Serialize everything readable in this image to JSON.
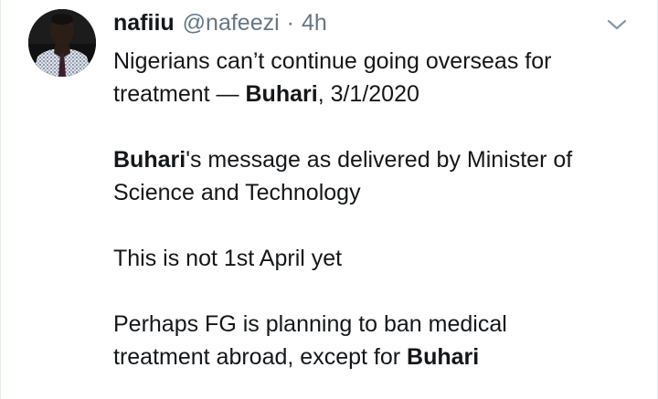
{
  "tweet": {
    "author": {
      "display_name": "nafiiu",
      "handle": "@nafeezi",
      "separator": "·",
      "time": "4h",
      "avatar_icon": "profile-photo"
    },
    "menu_icon": "chevron-down-icon",
    "paragraphs": [
      {
        "lines": [
          [
            {
              "text": "Nigerians can’t continue going overseas for",
              "bold": false
            }
          ],
          [
            {
              "text": "treatment — ",
              "bold": false
            },
            {
              "text": "Buhari",
              "bold": true
            },
            {
              "text": ", 3/1/2020",
              "bold": false
            }
          ]
        ]
      },
      {
        "lines": [
          [
            {
              "text": "Buhari",
              "bold": true
            },
            {
              "text": "'s message as delivered by Minister of",
              "bold": false
            }
          ],
          [
            {
              "text": "Science and Technology",
              "bold": false
            }
          ]
        ]
      },
      {
        "lines": [
          [
            {
              "text": "This is not 1st April yet",
              "bold": false
            }
          ]
        ]
      },
      {
        "lines": [
          [
            {
              "text": "Perhaps FG is planning to ban medical",
              "bold": false
            }
          ],
          [
            {
              "text": "treatment abroad, except for ",
              "bold": false
            },
            {
              "text": "Buhari",
              "bold": true
            }
          ]
        ]
      }
    ],
    "colors": {
      "text": "#14171a",
      "secondary": "#657786",
      "border": "#e6ecf0"
    }
  }
}
